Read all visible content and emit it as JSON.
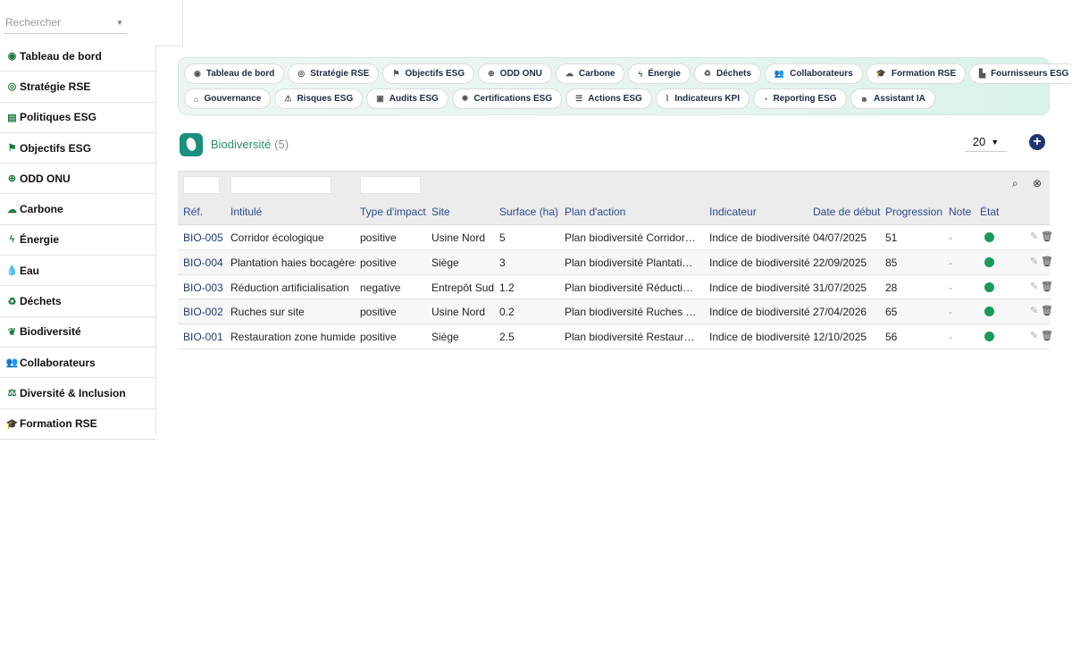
{
  "search": {
    "placeholder": "Rechercher"
  },
  "sidebar": {
    "items": [
      {
        "label": "Tableau de bord",
        "icon": "gauge-icon",
        "glyph": "◉"
      },
      {
        "label": "Stratégie RSE",
        "icon": "target-icon",
        "glyph": "◎"
      },
      {
        "label": "Politiques ESG",
        "icon": "policy-icon",
        "glyph": "▤"
      },
      {
        "label": "Objectifs ESG",
        "icon": "flag-icon",
        "glyph": "⚑"
      },
      {
        "label": "ODD ONU",
        "icon": "globe-icon",
        "glyph": "⊕"
      },
      {
        "label": "Carbone",
        "icon": "cloud-icon",
        "glyph": "☁"
      },
      {
        "label": "Énergie",
        "icon": "bolt-icon",
        "glyph": "ϟ"
      },
      {
        "label": "Eau",
        "icon": "water-drop-icon",
        "glyph": "💧"
      },
      {
        "label": "Déchets",
        "icon": "recycle-icon",
        "glyph": "♻"
      },
      {
        "label": "Biodiversité",
        "icon": "leaf-icon",
        "glyph": "❦"
      },
      {
        "label": "Collaborateurs",
        "icon": "users-icon",
        "glyph": "👥"
      },
      {
        "label": "Diversité & Inclusion",
        "icon": "balance-icon",
        "glyph": "⚖"
      },
      {
        "label": "Formation RSE",
        "icon": "graduation-cap-icon",
        "glyph": "🎓"
      }
    ]
  },
  "quick": {
    "row1": [
      {
        "label": "Tableau de bord",
        "icon": "gauge-icon",
        "glyph": "◉"
      },
      {
        "label": "Stratégie RSE",
        "icon": "target-icon",
        "glyph": "◎"
      },
      {
        "label": "Objectifs ESG",
        "icon": "flag-icon",
        "glyph": "⚑"
      },
      {
        "label": "ODD ONU",
        "icon": "globe-icon",
        "glyph": "⊕"
      },
      {
        "label": "Carbone",
        "icon": "cloud-icon",
        "glyph": "☁"
      },
      {
        "label": "Énergie",
        "icon": "bolt-icon",
        "glyph": "ϟ"
      },
      {
        "label": "Déchets",
        "icon": "recycle-icon",
        "glyph": "♻"
      },
      {
        "label": "Collaborateurs",
        "icon": "users-icon",
        "glyph": "👥"
      },
      {
        "label": "Formation RSE",
        "icon": "graduation-cap-icon",
        "glyph": "🎓"
      },
      {
        "label": "Fournisseurs ESG",
        "icon": "factory-icon",
        "glyph": "▙"
      }
    ],
    "row2": [
      {
        "label": "Gouvernance",
        "icon": "institution-icon",
        "glyph": "⌂"
      },
      {
        "label": "Risques ESG",
        "icon": "warning-icon",
        "glyph": "⚠"
      },
      {
        "label": "Audits ESG",
        "icon": "clipboard-icon",
        "glyph": "▣"
      },
      {
        "label": "Certifications ESG",
        "icon": "certificate-icon",
        "glyph": "✹"
      },
      {
        "label": "Actions ESG",
        "icon": "list-icon",
        "glyph": "☰"
      },
      {
        "label": "Indicateurs KPI",
        "icon": "chart-line-icon",
        "glyph": "⌇"
      },
      {
        "label": "Reporting ESG",
        "icon": "pie-chart-icon",
        "glyph": "◔"
      },
      {
        "label": "Assistant IA",
        "icon": "robot-icon",
        "glyph": "☻"
      }
    ]
  },
  "list": {
    "title": "Biodiversité",
    "count": "(5)",
    "page_size": "20"
  },
  "table": {
    "headers": [
      "Réf.",
      "Intitulé",
      "Type d'impact",
      "Site",
      "Surface (ha)",
      "Plan d'action",
      "Indicateur",
      "Date de début",
      "Progression",
      "Note",
      "État"
    ],
    "rows": [
      {
        "ref": "BIO-005",
        "title": "Corridor écologique",
        "impact": "positive",
        "site": "Usine Nord",
        "surface": "5",
        "plan": "Plan biodiversité Corridor écologique",
        "indicator": "Indice de biodiversité",
        "date": "04/07/2025",
        "progress": "51",
        "note": "-"
      },
      {
        "ref": "BIO-004",
        "title": "Plantation haies bocagères",
        "impact": "positive",
        "site": "Siège",
        "surface": "3",
        "plan": "Plan biodiversité Plantation haies bocagères",
        "indicator": "Indice de biodiversité",
        "date": "22/09/2025",
        "progress": "85",
        "note": "-"
      },
      {
        "ref": "BIO-003",
        "title": "Réduction artificialisation",
        "impact": "negative",
        "site": "Entrepôt Sud",
        "surface": "1.2",
        "plan": "Plan biodiversité Réduction artificialisation",
        "indicator": "Indice de biodiversité",
        "date": "31/07/2025",
        "progress": "28",
        "note": "-"
      },
      {
        "ref": "BIO-002",
        "title": "Ruches sur site",
        "impact": "positive",
        "site": "Usine Nord",
        "surface": "0.2",
        "plan": "Plan biodiversité Ruches sur site",
        "indicator": "Indice de biodiversité",
        "date": "27/04/2026",
        "progress": "65",
        "note": "-"
      },
      {
        "ref": "BIO-001",
        "title": "Restauration zone humide",
        "impact": "positive",
        "site": "Siège",
        "surface": "2.5",
        "plan": "Plan biodiversité Restauration zone humide",
        "indicator": "Indice de biodiversité",
        "date": "12/10/2025",
        "progress": "56",
        "note": "-"
      }
    ]
  },
  "colors": {
    "accent": "#1f3672",
    "brand": "#1a8f7d",
    "status_ok": "#1a9a5a",
    "title": "#2a8f66"
  }
}
